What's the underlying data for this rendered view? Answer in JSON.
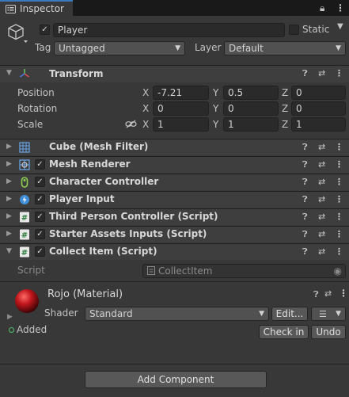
{
  "tab": {
    "title": "Inspector",
    "icon": "info-icon"
  },
  "tabbar_icons": {
    "lock": "lock-icon",
    "menu": "kebab-menu-icon"
  },
  "header": {
    "name": "Player",
    "active": true,
    "static_label": "Static",
    "tag_label": "Tag",
    "tag_value": "Untagged",
    "layer_label": "Layer",
    "layer_value": "Default"
  },
  "transform": {
    "title": "Transform",
    "position_label": "Position",
    "rotation_label": "Rotation",
    "scale_label": "Scale",
    "axis_x": "X",
    "axis_y": "Y",
    "axis_z": "Z",
    "position": {
      "x": "-7.21",
      "y": "0.5",
      "z": "0"
    },
    "rotation": {
      "x": "0",
      "y": "0",
      "z": "0"
    },
    "scale": {
      "x": "1",
      "y": "1",
      "z": "1"
    }
  },
  "components": [
    {
      "title": "Cube (Mesh Filter)",
      "icon": "mesh-filter-icon",
      "checkbox": false
    },
    {
      "title": "Mesh Renderer",
      "icon": "mesh-renderer-icon",
      "checkbox": true
    },
    {
      "title": "Character Controller",
      "icon": "character-controller-icon",
      "checkbox": true
    },
    {
      "title": "Player Input",
      "icon": "player-input-icon",
      "checkbox": true
    },
    {
      "title": "Third Person Controller (Script)",
      "icon": "script-icon",
      "checkbox": true
    },
    {
      "title": "Starter Assets Inputs (Script)",
      "icon": "script-icon",
      "checkbox": true
    },
    {
      "title": "Collect Item (Script)",
      "icon": "script-icon",
      "checkbox": true
    }
  ],
  "collect_item": {
    "script_label": "Script",
    "script_value": "CollectItem"
  },
  "material": {
    "title": "Rojo (Material)",
    "shader_label": "Shader",
    "shader_value": "Standard",
    "edit_label": "Edit...",
    "added_label": "Added",
    "checkin_label": "Check in",
    "undo_label": "Undo",
    "color": "#c0161c"
  },
  "add_component_label": "Add Component",
  "colors": {
    "accent": "#3a79bb",
    "added": "#4fc16b"
  }
}
